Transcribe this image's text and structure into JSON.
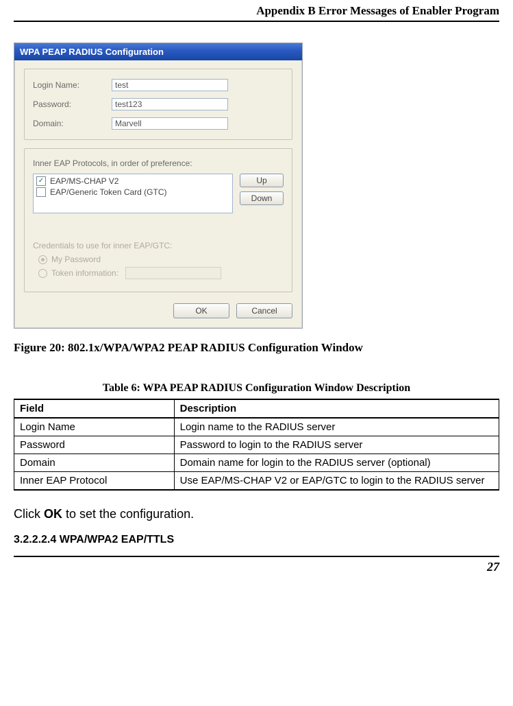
{
  "header": {
    "appendix": "Appendix B Error Messages of Enabler Program"
  },
  "dialog": {
    "title": "WPA PEAP RADIUS Configuration",
    "fields": {
      "login_label": "Login Name:",
      "login_value": "test",
      "password_label": "Password:",
      "password_value": "test123",
      "domain_label": "Domain:",
      "domain_value": "Marvell"
    },
    "eap": {
      "caption": "Inner EAP Protocols, in order of preference:",
      "item1": "EAP/MS-CHAP V2",
      "item2": "EAP/Generic Token Card (GTC)",
      "up": "Up",
      "down": "Down"
    },
    "cred": {
      "caption": "Credentials to use for inner EAP/GTC:",
      "opt1": "My Password",
      "opt2": "Token information:"
    },
    "buttons": {
      "ok": "OK",
      "cancel": "Cancel"
    }
  },
  "figure": {
    "prefix": "Figure 20: ",
    "text": "802.1x/WPA/WPA2 PEAP RADIUS Configuration Window"
  },
  "table_caption": "Table 6: WPA PEAP RADIUS Configuration Window Description",
  "table": {
    "h1": "Field",
    "h2": "Description",
    "rows": [
      {
        "f": "Login Name",
        "d": "Login name to the RADIUS server"
      },
      {
        "f": "Password",
        "d": "Password to login to the RADIUS server"
      },
      {
        "f": "Domain",
        "d": "Domain name for login to the RADIUS server (optional)"
      },
      {
        "f": "Inner EAP Protocol",
        "d": "Use EAP/MS-CHAP V2 or EAP/GTC to login to the RADIUS server"
      }
    ]
  },
  "instruction": {
    "pre": "Click ",
    "bold": "OK",
    "post": " to set the configuration."
  },
  "subheading": "3.2.2.2.4 WPA/WPA2 EAP/TTLS",
  "page_number": "27"
}
